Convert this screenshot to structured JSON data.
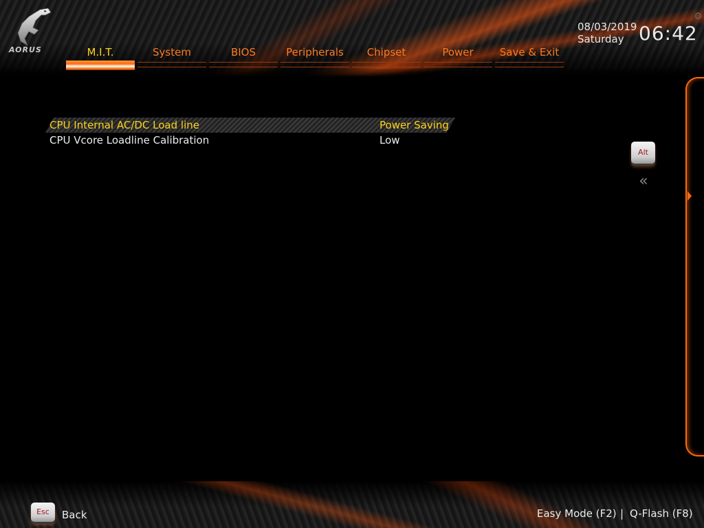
{
  "brand": {
    "logo_icon": "aorus-eagle-logo",
    "logo_text": "AORUS"
  },
  "tabs": [
    {
      "label": "M.I.T.",
      "active": true
    },
    {
      "label": "System",
      "active": false
    },
    {
      "label": "BIOS",
      "active": false
    },
    {
      "label": "Peripherals",
      "active": false
    },
    {
      "label": "Chipset",
      "active": false
    },
    {
      "label": "Power",
      "active": false
    },
    {
      "label": "Save & Exit",
      "active": false
    }
  ],
  "clock": {
    "date": "08/03/2019",
    "weekday": "Saturday",
    "time": "06:42",
    "settings_icon": "gear-icon"
  },
  "settings": [
    {
      "label": "CPU Internal AC/DC Load line",
      "value": "Power Saving",
      "selected": true
    },
    {
      "label": "CPU Vcore Loadline Calibration",
      "value": "Low",
      "selected": false
    }
  ],
  "side_controls": {
    "alt_label": "Alt",
    "collapse_icon": "double-chevron-left-icon",
    "panel_arrow_icon": "chevron-right-icon"
  },
  "footer": {
    "esc_label": "Esc",
    "back_label": "Back",
    "easy_mode": "Easy Mode (F2)",
    "separator": "|",
    "qflash": "Q-Flash (F8)"
  },
  "colors": {
    "accent_orange": "#ff7b1f",
    "selected_yellow": "#ffd21a",
    "text_white": "#ececec",
    "background": "#000000"
  }
}
